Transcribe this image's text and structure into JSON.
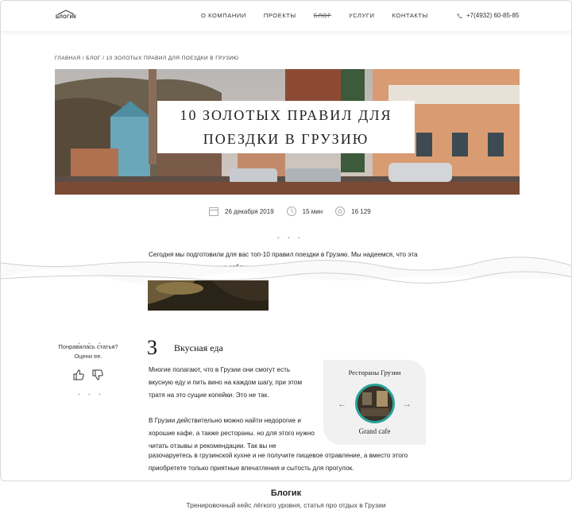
{
  "header": {
    "logo_text": "БЛОГИК",
    "nav": [
      "О КОМПАНИИ",
      "ПРОЕКТЫ",
      "БЛОГ",
      "УСЛУГИ",
      "КОНТАКТЫ"
    ],
    "phone": "+7(4932) 60-85-85"
  },
  "breadcrumb": "ГЛАВНАЯ / БЛОГ / 10 ЗОЛОТЫХ ПРАВИЛ ДЛЯ ПОЕЗДКИ В ГРУЗИЮ",
  "hero": {
    "title_line1": "10 ЗОЛОТЫХ ПРАВИЛ ДЛЯ",
    "title_line2": "ПОЕЗДКИ В ГРУЗИЮ"
  },
  "meta": {
    "date": "26 декабря 2019",
    "read_time": "15 мин",
    "views": "16 129"
  },
  "dots": "• • •",
  "intro_text": "Сегодня мы подготовили для вас топ-10 правил поездки в Грузию. Мы надеемся, что эта статья развеет некоторые заблуждения и ложные ожидания и сделает",
  "like": {
    "question": "Понравилась статья?",
    "prompt": "Оцени ее."
  },
  "section": {
    "number": "3",
    "title": "Вкусная еда",
    "para1": "Многие полагают, что в Грузии они смогут есть вкусную еду и пить вино на каждом шагу, при этом тратя на это сущие копейки. Это не так.",
    "para2": "В Грузии действительно можно найти недорогие и хорошие кафе, а также рестораны. но для этого нужно читать отзывы и рекомендации. Так вы не",
    "para3": "разочаруетесь в грузинской кухне и не получите пищевое отравление, а вместо этого приобретете только приятные впечатления и сытость для прогулок."
  },
  "card": {
    "title": "Рестораны Грузии",
    "name": "Grand cafe",
    "prev": "←",
    "next": "→",
    "accent": "#29a39a"
  },
  "footer": {
    "title": "Блогик",
    "subtitle": "Тренировочный кейс лёгкого уровня, статья про отдых в Грузии"
  }
}
